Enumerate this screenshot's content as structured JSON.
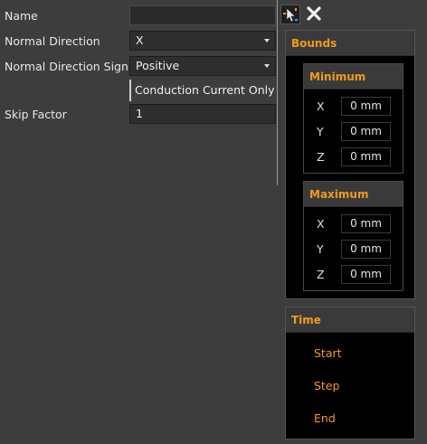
{
  "form": {
    "name_label": "Name",
    "name_value": "",
    "normal_direction_label": "Normal Direction",
    "normal_direction_value": "X",
    "normal_direction_sign_label": "Normal Direction Sign",
    "normal_direction_sign_value": "Positive",
    "conduction_label": "Conduction Current Only",
    "skip_factor_label": "Skip Factor",
    "skip_factor_value": "1"
  },
  "icons": {
    "settings": "cursor-select-icon",
    "close": "close-icon"
  },
  "bounds": {
    "title": "Bounds",
    "minimum": {
      "title": "Minimum",
      "rows": [
        {
          "axis": "X",
          "value": "0 mm"
        },
        {
          "axis": "Y",
          "value": "0 mm"
        },
        {
          "axis": "Z",
          "value": "0 mm"
        }
      ]
    },
    "maximum": {
      "title": "Maximum",
      "rows": [
        {
          "axis": "X",
          "value": "0 mm"
        },
        {
          "axis": "Y",
          "value": "0 mm"
        },
        {
          "axis": "Z",
          "value": "0 mm"
        }
      ]
    }
  },
  "time": {
    "title": "Time",
    "items": [
      "Start",
      "Step",
      "End"
    ]
  },
  "colors": {
    "accent": "#f39a1b",
    "background": "#3d3d3d",
    "panel": "#000000"
  }
}
